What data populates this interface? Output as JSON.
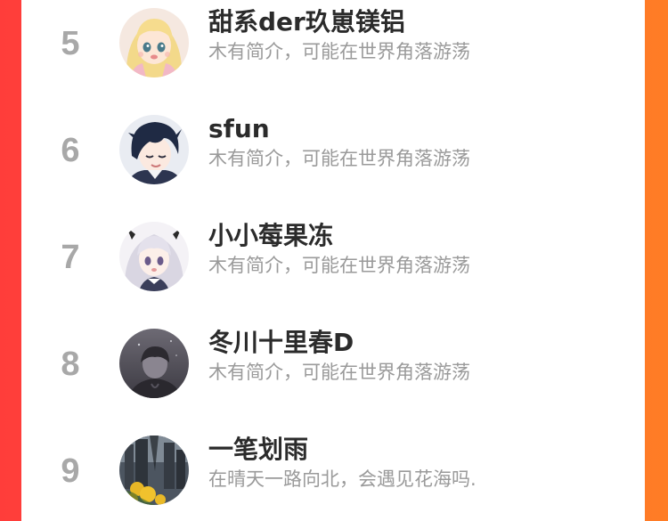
{
  "colors": {
    "background_gradient_start": "#ff3d3a",
    "background_gradient_end": "#ff7d25",
    "card": "#ffffff",
    "rank_text": "#a8a8a8",
    "name_text": "#2b2b2b",
    "bio_text": "#9a9a9a"
  },
  "ranking": {
    "rows": [
      {
        "rank": "5",
        "name": "甜系der玖崽镁铝",
        "bio": "木有简介，可能在世界角落游荡",
        "avatar_icon": "anime-girl-blonde-avatar"
      },
      {
        "rank": "6",
        "name": "sfun",
        "bio": "木有简介，可能在世界角落游荡",
        "avatar_icon": "anime-boy-dark-hair-avatar"
      },
      {
        "rank": "7",
        "name": "小小莓果冻",
        "bio": "木有简介，可能在世界角落游荡",
        "avatar_icon": "anime-girl-silver-hair-avatar"
      },
      {
        "rank": "8",
        "name": "冬川十里春D",
        "bio": "木有简介，可能在世界角落游荡",
        "avatar_icon": "dark-figure-avatar"
      },
      {
        "rank": "9",
        "name": "一笔划雨",
        "bio": "在晴天一路向北，会遇见花海吗.",
        "avatar_icon": "city-flowers-avatar"
      }
    ]
  }
}
